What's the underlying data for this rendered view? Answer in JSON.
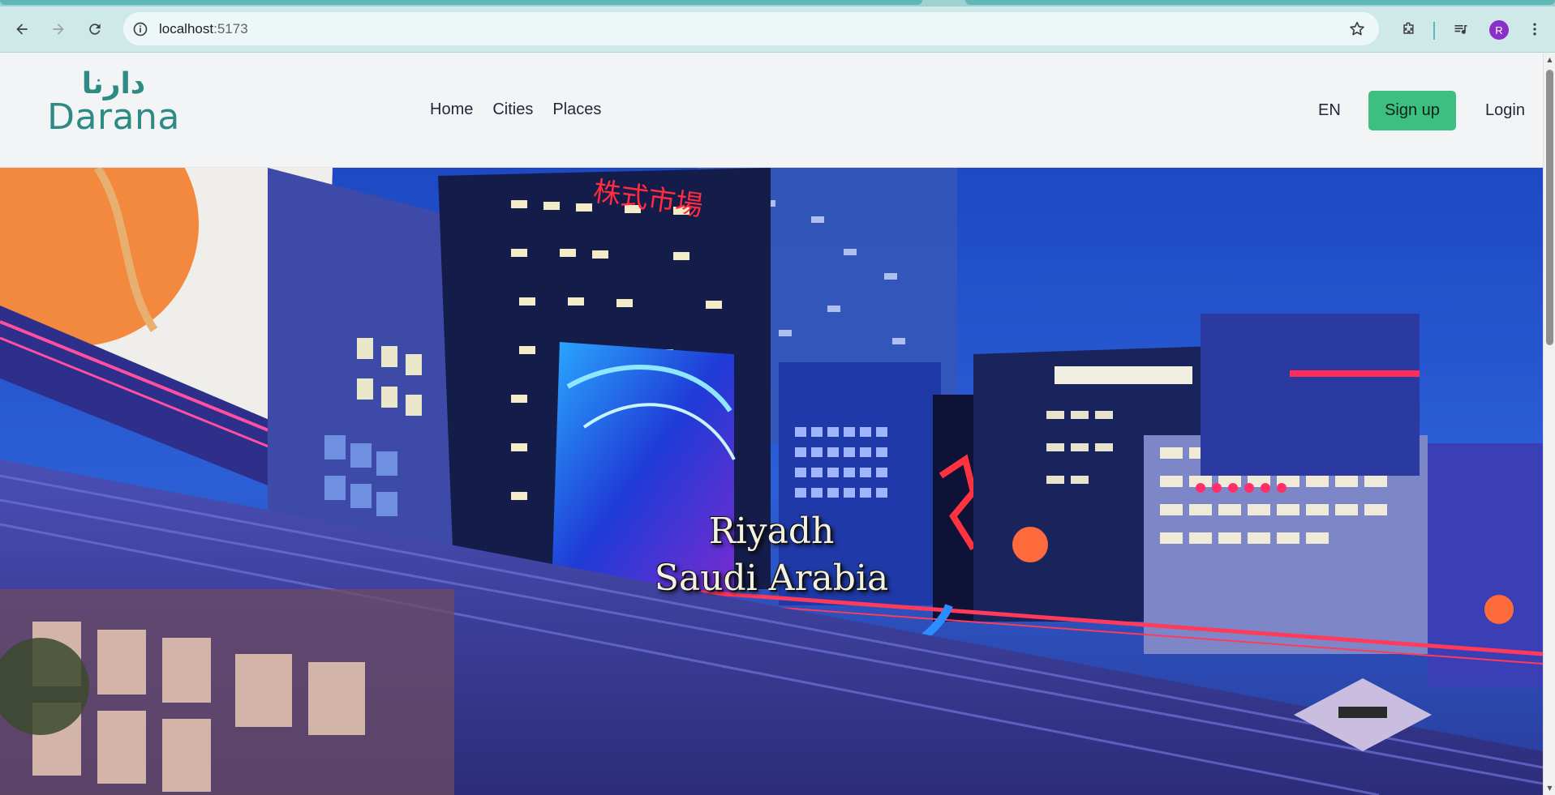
{
  "browser": {
    "url_host": "localhost",
    "url_port": ":5173",
    "profile_initial": "R"
  },
  "site": {
    "logo_arabic": "دارنا",
    "logo_text": "Darana",
    "nav": [
      {
        "label": "Home"
      },
      {
        "label": "Cities"
      },
      {
        "label": "Places"
      }
    ],
    "language": "EN",
    "signup_label": "Sign up",
    "login_label": "Login"
  },
  "hero": {
    "city": "Riyadh",
    "country": "Saudi Arabia",
    "sign_text": "株式市場"
  },
  "colors": {
    "brand": "#2e8b84",
    "signup_bg": "#3dbf7f",
    "chrome": "#cfe9e9",
    "avatar": "#8b2fc9"
  },
  "icons": [
    "back-icon",
    "forward-icon",
    "reload-icon",
    "site-info-icon",
    "bookmark-star-icon",
    "extensions-icon",
    "media-controls-icon",
    "kebab-menu-icon"
  ]
}
